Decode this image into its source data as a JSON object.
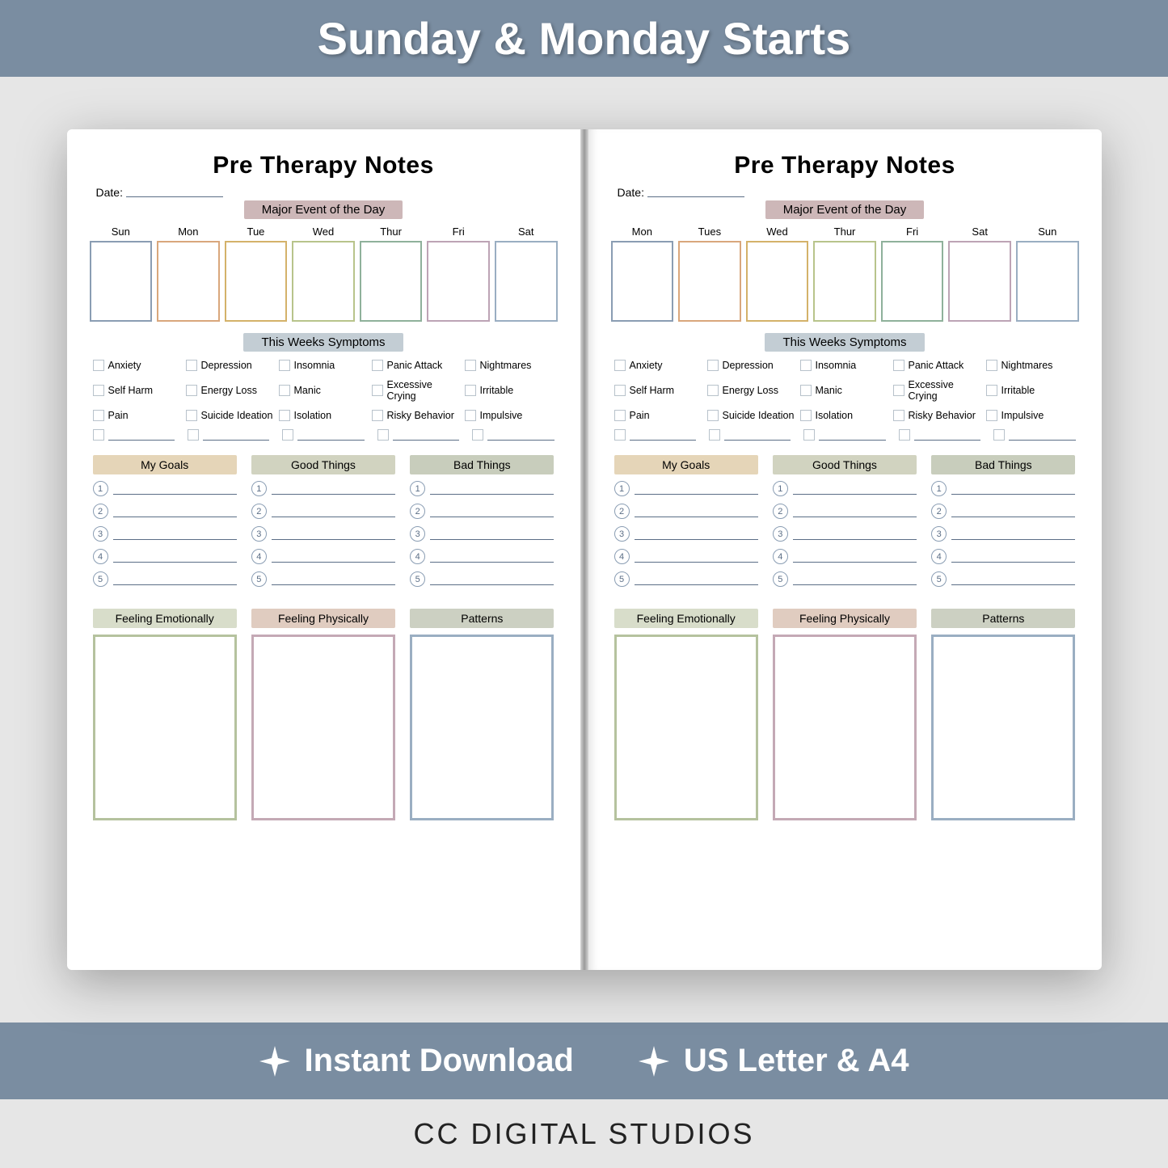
{
  "bannerTop": "Sunday & Monday Starts",
  "bannerBot": {
    "left": "Instant Download",
    "right": "US Letter & A4"
  },
  "footer": "CC DIGITAL STUDIOS",
  "page": {
    "title": "Pre Therapy Notes",
    "dateLabel": "Date:",
    "majorEvent": "Major Event of the Day",
    "symptomsHeader": "This Weeks Symptoms",
    "symptoms": [
      "Anxiety",
      "Depression",
      "Insomnia",
      "Panic Attack",
      "Nightmares",
      "Self Harm",
      "Energy Loss",
      "Manic",
      "Excessive Crying",
      "Irritable",
      "Pain",
      "Suicide Ideation",
      "Isolation",
      "Risky Behavior",
      "Impulsive"
    ],
    "cols": {
      "goals": "My Goals",
      "good": "Good Things",
      "bad": "Bad Things"
    },
    "boxes": {
      "emo": "Feeling Emotionally",
      "phy": "Feeling Physically",
      "pat": "Patterns"
    },
    "nums": [
      "1",
      "2",
      "3",
      "4",
      "5"
    ]
  },
  "left": {
    "days": [
      "Sun",
      "Mon",
      "Tue",
      "Wed",
      "Thur",
      "Fri",
      "Sat"
    ]
  },
  "right": {
    "days": [
      "Mon",
      "Tues",
      "Wed",
      "Thur",
      "Fri",
      "Sat",
      "Sun"
    ]
  }
}
